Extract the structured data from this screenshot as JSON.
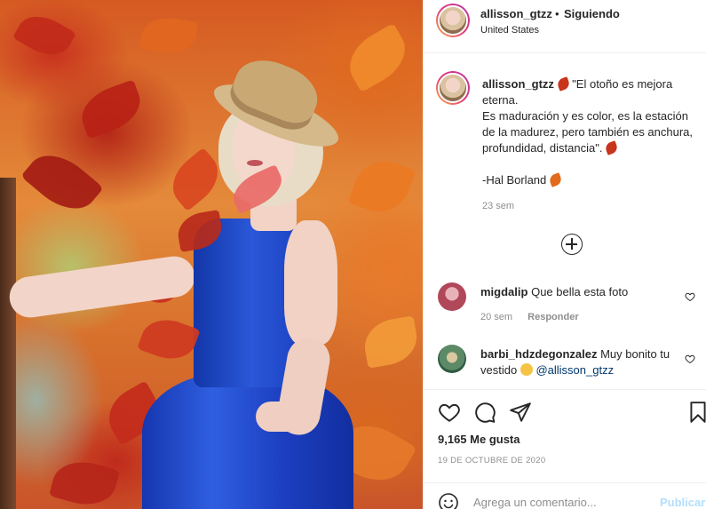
{
  "post": {
    "author": "allisson_gtzz",
    "separator": "•",
    "follow_status": "Siguiendo",
    "location": "United States"
  },
  "caption": {
    "author": "allisson_gtzz",
    "line1": "\"El otoño es mejora eterna.",
    "line2": "Es maduración y es color, es la estación de la madurez, pero también es anchura, profundidad, distancia\".",
    "signature": "-Hal Borland",
    "time": "23 sem",
    "emojis": [
      "maple-leaf",
      "fallen-leaf"
    ]
  },
  "comments": [
    {
      "user": "migdalip",
      "text": "Que bella esta foto",
      "time": "20 sem",
      "reply_label": "Responder",
      "avatar_color": "#b0485a"
    },
    {
      "user": "barbi_hdzdegonzalez",
      "text": "Muy bonito tu vestido",
      "mention": "@allisson_gtzz",
      "avatar_color": "#4a7a5a"
    }
  ],
  "stats": {
    "likes": "9,165 Me gusta",
    "date": "19 DE OCTUBRE DE 2020"
  },
  "composer": {
    "placeholder": "Agrega un comentario...",
    "publish_label": "Publicar"
  },
  "icons": [
    "heart-icon",
    "comment-icon",
    "share-icon",
    "bookmark-icon",
    "emoji-icon",
    "plus-circle-icon"
  ]
}
